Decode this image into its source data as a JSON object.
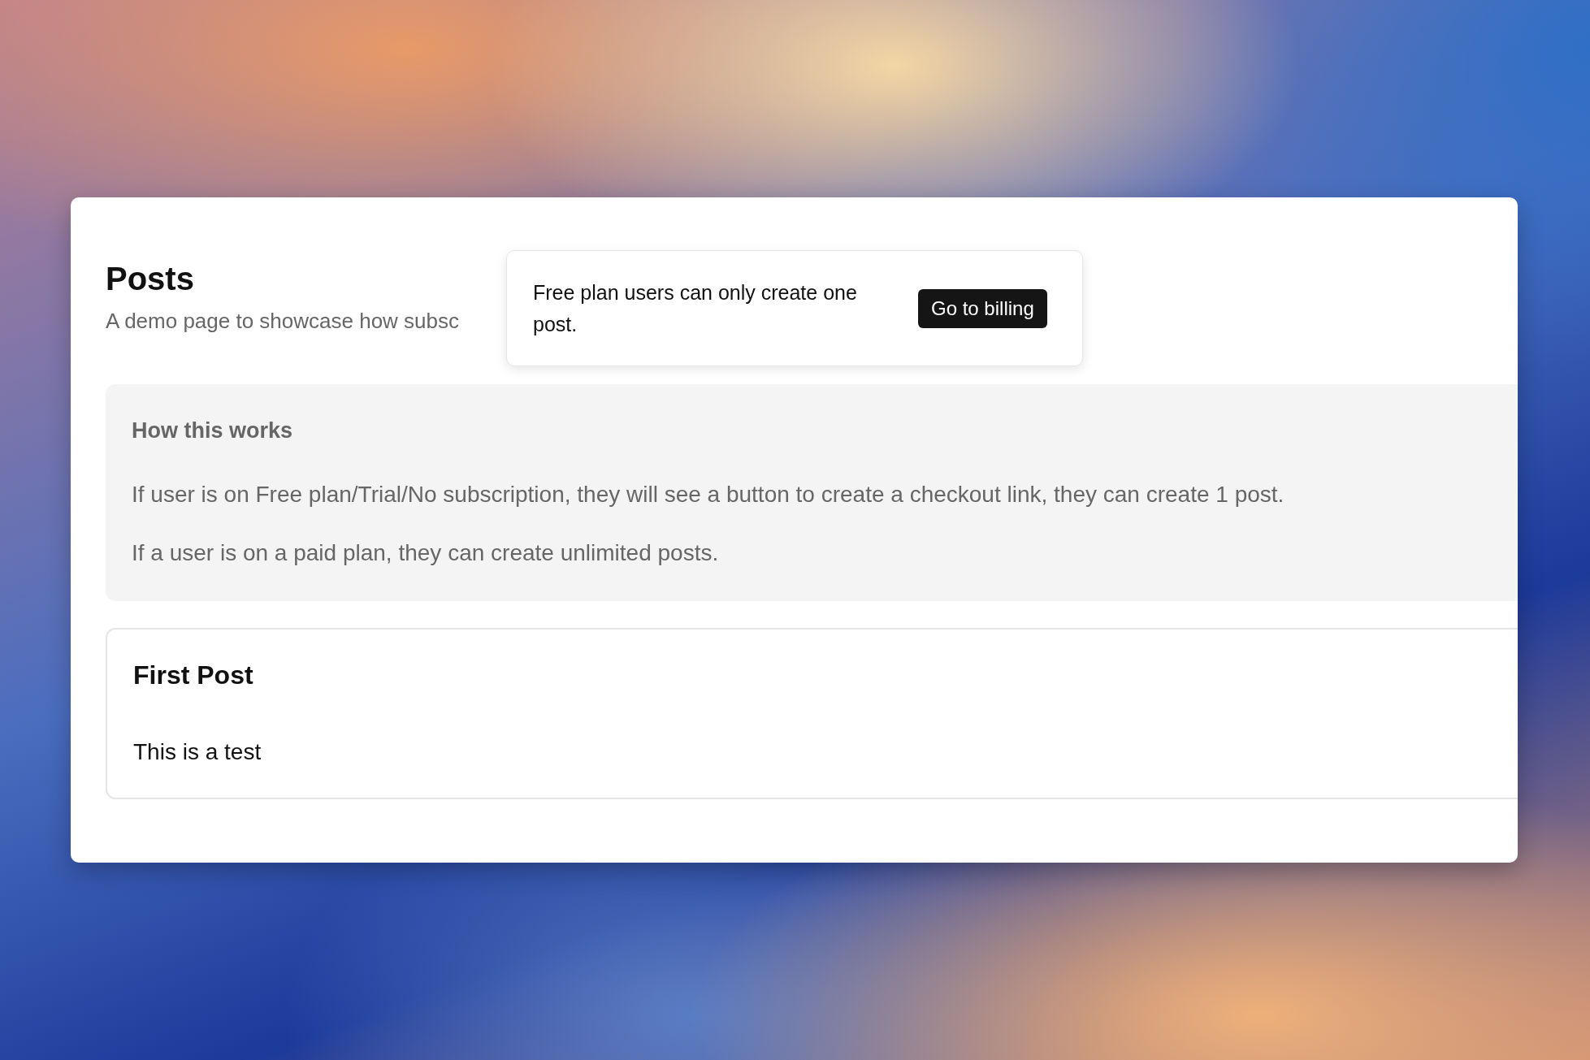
{
  "page": {
    "title": "Posts",
    "subtitle": "A demo page to showcase how subsc"
  },
  "popover": {
    "message": "Free plan users can only create one post.",
    "button": "Go to billing"
  },
  "info": {
    "heading": "How this works",
    "paragraphs": [
      "If user is on Free plan/Trial/No subscription, they will see a button to create a checkout link, they can create 1 post.",
      "If a user is on a paid plan, they can create unlimited posts."
    ]
  },
  "posts": [
    {
      "title": "First Post",
      "body": "This is a test"
    }
  ]
}
